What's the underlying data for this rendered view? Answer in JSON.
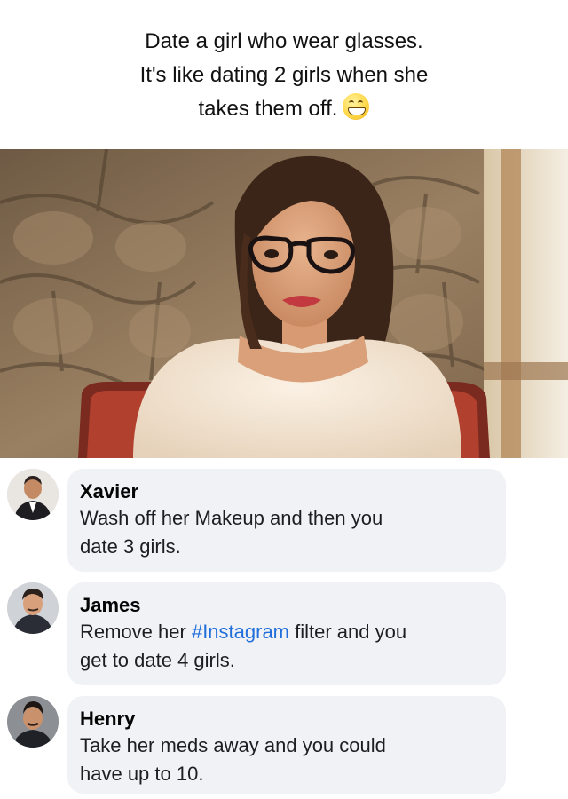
{
  "post": {
    "caption_lines": [
      "Date a girl who wear glasses.",
      "It's like dating 2 girls when she",
      "takes them off."
    ],
    "emoji_icon": "grinning-face-emoji"
  },
  "comments": [
    {
      "author": "Xavier",
      "text_line_1": "Wash off her Makeup and then you",
      "text_line_2": "date 3 girls."
    },
    {
      "author": "James",
      "text_before": "Remove her ",
      "hashtag": "#Instagram",
      "text_after": " filter and you",
      "text_line_2": "get to date 4 girls."
    },
    {
      "author": "Henry",
      "text_line_1": "Take her meds away and you could",
      "text_line_2": "have up to 10."
    }
  ],
  "colors": {
    "bubble_bg": "#f0f2f5",
    "hashtag": "#216fdb"
  }
}
